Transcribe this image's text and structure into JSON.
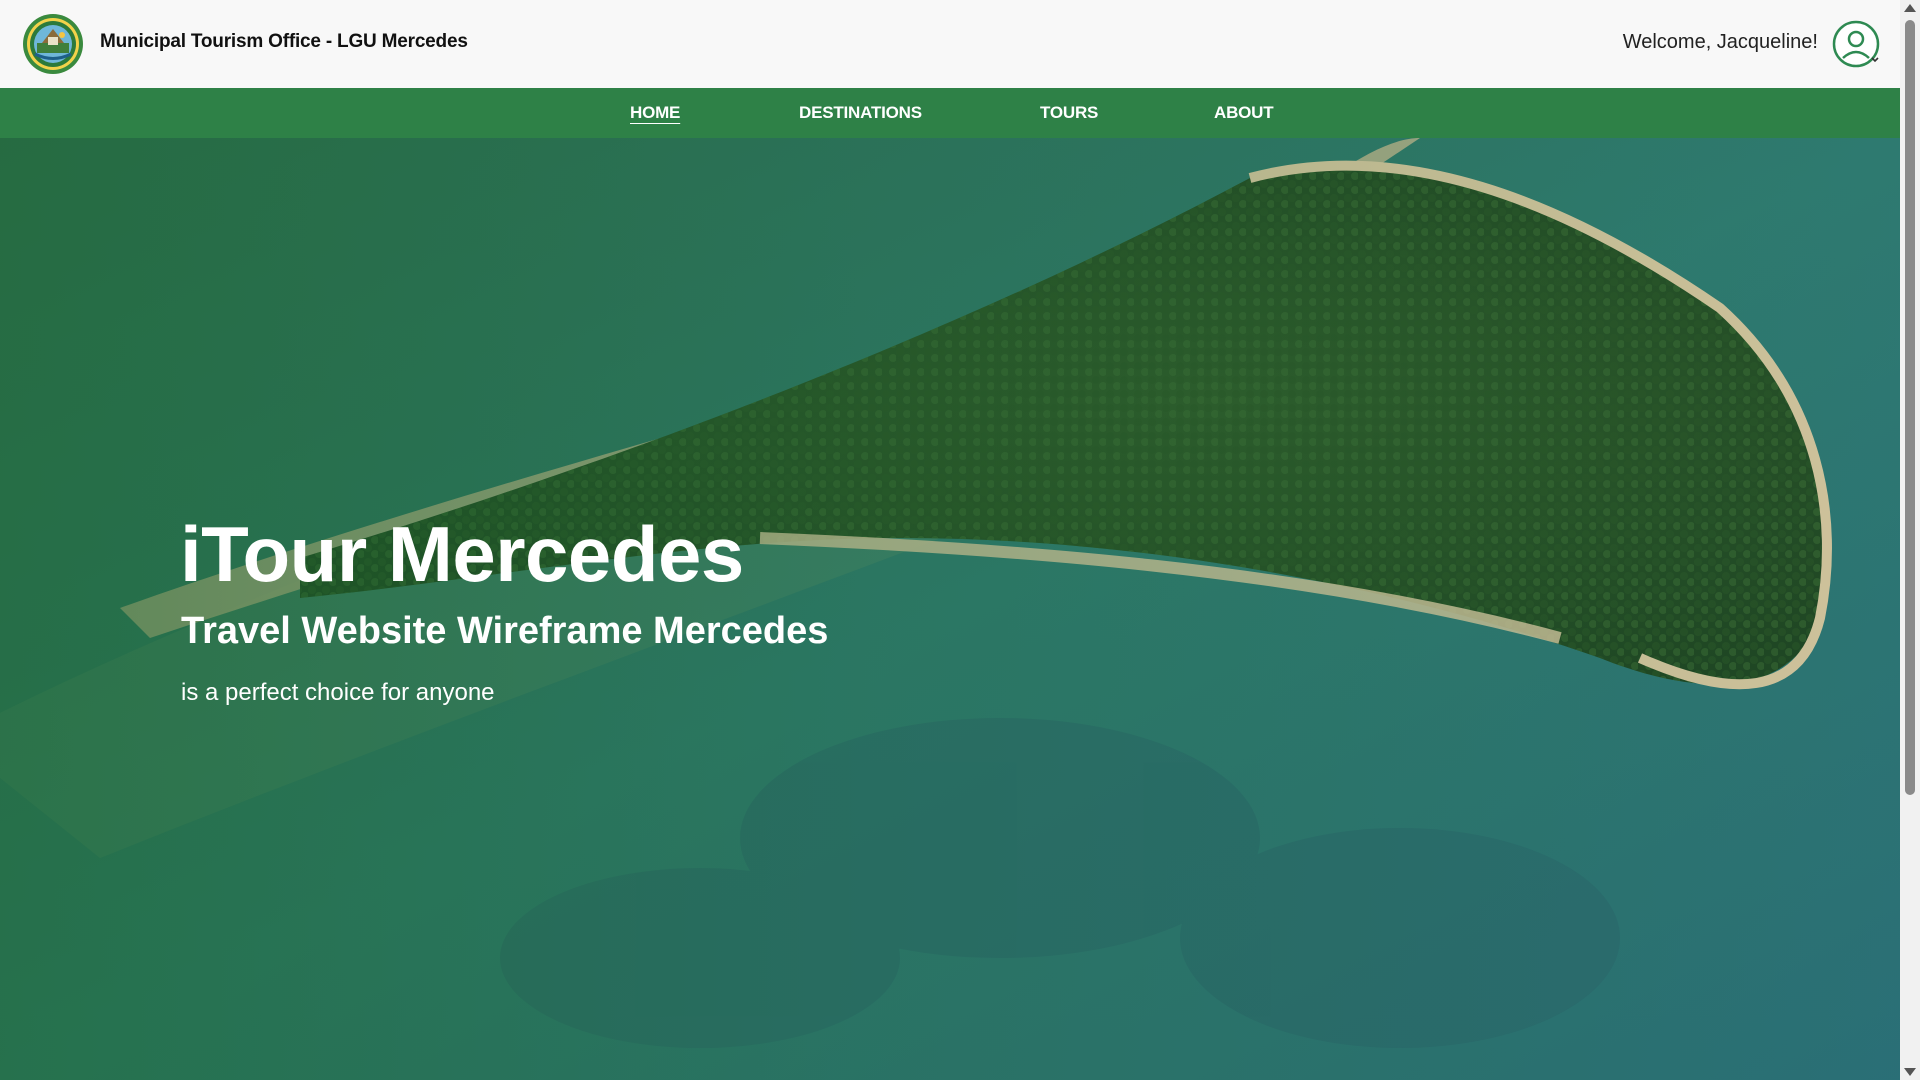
{
  "header": {
    "site_title": "Municipal Tourism Office - LGU Mercedes",
    "welcome_text": "Welcome, Jacqueline!",
    "logo_icon": "municipal-seal-logo",
    "avatar_icon": "user-avatar-icon"
  },
  "nav": {
    "items": [
      {
        "label": "HOME",
        "active": true
      },
      {
        "label": "DESTINATIONS",
        "active": false
      },
      {
        "label": "TOURS",
        "active": false
      },
      {
        "label": "ABOUT",
        "active": false
      }
    ]
  },
  "hero": {
    "title": "iTour Mercedes",
    "subtitle": "Travel Website Wireframe Mercedes",
    "tagline": "is a perfect choice for anyone"
  },
  "colors": {
    "nav_green": "#2e8147",
    "avatar_green": "#2e8a52",
    "header_bg": "#f8f8f8"
  }
}
